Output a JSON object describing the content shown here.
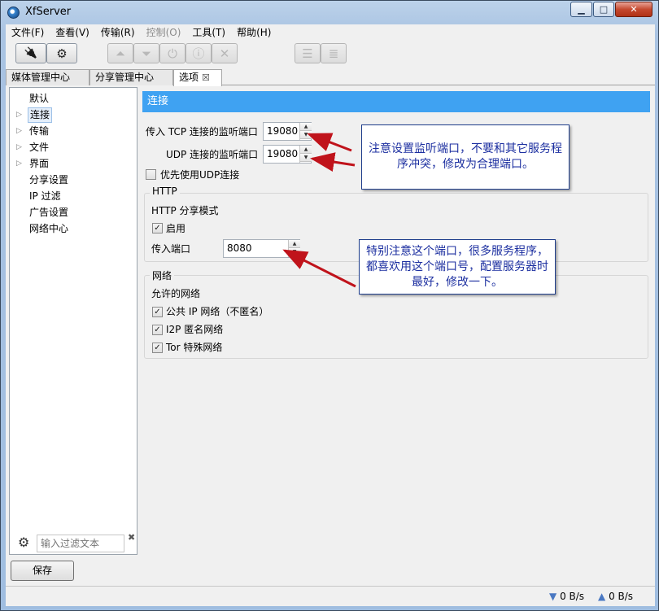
{
  "window": {
    "title": "XfServer",
    "min_glyph": "▁",
    "max_glyph": "□",
    "close_glyph": "✕"
  },
  "menu": [
    "文件(F)",
    "查看(V)",
    "传输(R)",
    "控制(O)",
    "工具(T)",
    "帮助(H)"
  ],
  "menu_disabled": [
    "控制(O)"
  ],
  "toolbar": {
    "buttons": [
      {
        "name": "connect-button",
        "icon": "plug-icon",
        "glyph": "🔌",
        "enabled": true
      },
      {
        "name": "settings-button",
        "icon": "gear-icon",
        "glyph": "⚙",
        "enabled": true
      },
      {
        "name": "move-up-button",
        "icon": "move-up-icon",
        "glyph": "⏶",
        "enabled": false
      },
      {
        "name": "move-down-button",
        "icon": "move-down-icon",
        "glyph": "⏷",
        "enabled": false
      },
      {
        "name": "power-button",
        "icon": "power-icon",
        "glyph": "⏻",
        "enabled": false
      },
      {
        "name": "info-button",
        "icon": "info-icon",
        "glyph": "ⓘ",
        "enabled": false
      },
      {
        "name": "remove-button",
        "icon": "close-icon",
        "glyph": "✕",
        "enabled": false
      },
      {
        "name": "list-view-button",
        "icon": "list-icon",
        "glyph": "☰",
        "enabled": false
      },
      {
        "name": "detail-view-button",
        "icon": "detail-list-icon",
        "glyph": "≣",
        "enabled": false
      }
    ]
  },
  "tabs": [
    {
      "label": "媒体管理中心",
      "active": false
    },
    {
      "label": "分享管理中心",
      "active": false
    },
    {
      "label": "选项",
      "active": true,
      "close": "☒"
    }
  ],
  "tree": {
    "items": [
      {
        "label": "默认",
        "expandable": false,
        "selected": false
      },
      {
        "label": "连接",
        "expandable": true,
        "selected": true
      },
      {
        "label": "传输",
        "expandable": true,
        "selected": false
      },
      {
        "label": "文件",
        "expandable": true,
        "selected": false
      },
      {
        "label": "界面",
        "expandable": true,
        "selected": false
      },
      {
        "label": "分享设置",
        "expandable": false,
        "selected": false
      },
      {
        "label": "IP 过滤",
        "expandable": false,
        "selected": false
      },
      {
        "label": "广告设置",
        "expandable": false,
        "selected": false
      },
      {
        "label": "网络中心",
        "expandable": false,
        "selected": false
      }
    ],
    "expand_glyph": "▷",
    "filter_placeholder": "输入过滤文本",
    "filter_gear": "⚙",
    "filter_clear": "✖"
  },
  "panel": {
    "header": "连接",
    "tcp_label": "传入 TCP 连接的监听端口",
    "tcp_port": "19080",
    "udp_label": "UDP 连接的监听端口",
    "udp_port": "19080",
    "prefer_udp_label": "优先使用UDP连接",
    "prefer_udp_checked": false,
    "http": {
      "group_title": "HTTP",
      "mode_label": "HTTP 分享模式",
      "enable_label": "启用",
      "enable_checked": true,
      "port_label": "传入端口",
      "port": "8080"
    },
    "network": {
      "group_title": "网络",
      "allowed_label": "允许的网络",
      "options": [
        {
          "label": "公共 IP 网络（不匿名）",
          "checked": true
        },
        {
          "label": "I2P 匿名网络",
          "checked": true
        },
        {
          "label": "Tor 特殊网络",
          "checked": true
        }
      ]
    },
    "check_glyph": "✓",
    "spin_up": "▲",
    "spin_down": "▼"
  },
  "annotations": [
    {
      "text": "注意设置监听端口，不要和其它服务程序冲突，修改为合理端口。"
    },
    {
      "text": "特别注意这个端口，很多服务程序，都喜欢用这个端口号，配置服务器时最好，修改一下。"
    }
  ],
  "colors": {
    "header_bg": "#3fa2f2",
    "annotation_arrow": "#c0131b",
    "annotation_text": "#1c2fa0"
  },
  "bottom": {
    "save_label": "保存"
  },
  "status": {
    "down_glyph": "▼",
    "down_rate": "0 B/s",
    "up_glyph": "▲",
    "up_rate": "0 B/s"
  }
}
